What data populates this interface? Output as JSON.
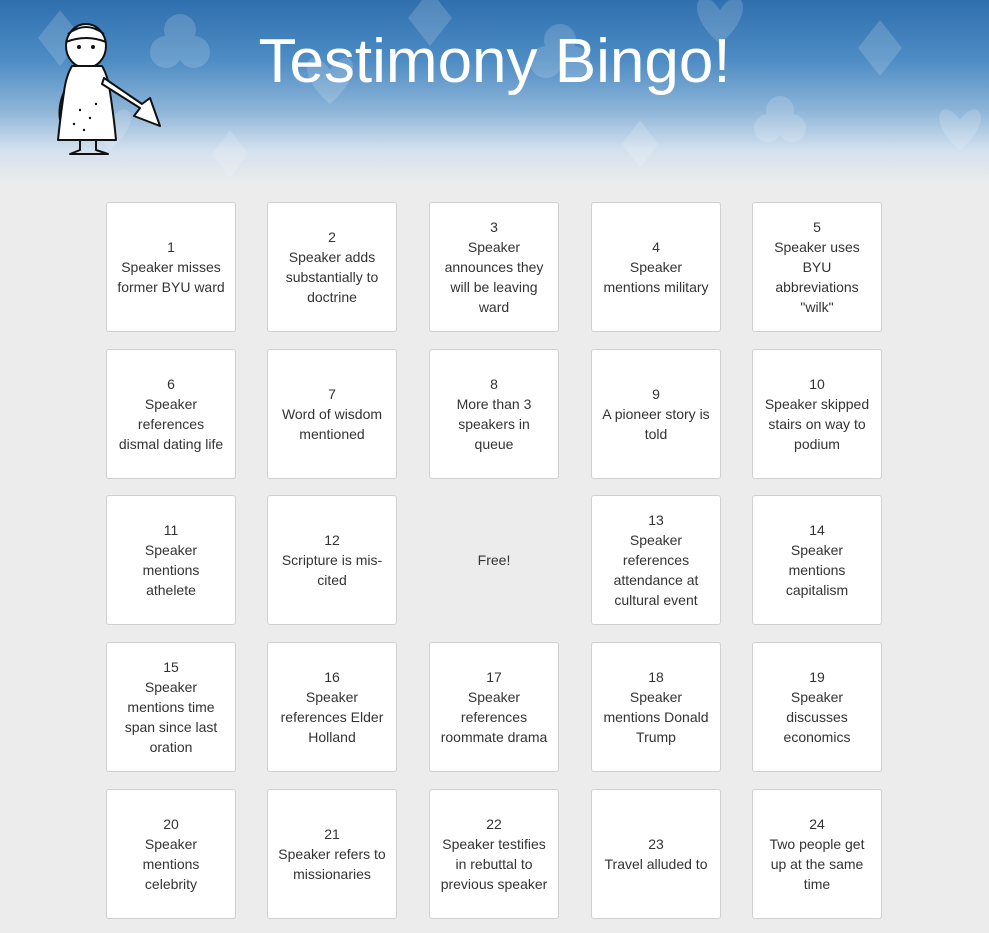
{
  "header": {
    "title": "Testimony Bingo!"
  },
  "mascot": {
    "icon": "pioneer-girl-trumpet-illustration"
  },
  "cards": [
    {
      "number": "1",
      "text": "Speaker misses former BYU ward"
    },
    {
      "number": "2",
      "text": "Speaker adds substantially to doctrine"
    },
    {
      "number": "3",
      "text": "Speaker announces they will be leaving ward"
    },
    {
      "number": "4",
      "text": "Speaker mentions military"
    },
    {
      "number": "5",
      "text": "Speaker uses BYU abbreviations \"wilk\""
    },
    {
      "number": "6",
      "text": "Speaker references dismal dating life"
    },
    {
      "number": "7",
      "text": "Word of wisdom mentioned"
    },
    {
      "number": "8",
      "text": "More than 3 speakers in queue"
    },
    {
      "number": "9",
      "text": "A pioneer story is told"
    },
    {
      "number": "10",
      "text": "Speaker skipped stairs on way to podium"
    },
    {
      "number": "11",
      "text": "Speaker mentions athelete"
    },
    {
      "number": "12",
      "text": "Scripture is mis-cited"
    },
    {
      "number": "",
      "text": "Free!",
      "free": true
    },
    {
      "number": "13",
      "text": "Speaker references attendance at cultural event"
    },
    {
      "number": "14",
      "text": "Speaker mentions capitalism"
    },
    {
      "number": "15",
      "text": "Speaker mentions time span since last oration"
    },
    {
      "number": "16",
      "text": "Speaker references Elder Holland"
    },
    {
      "number": "17",
      "text": "Speaker references roommate drama"
    },
    {
      "number": "18",
      "text": "Speaker mentions Donald Trump"
    },
    {
      "number": "19",
      "text": "Speaker discusses economics"
    },
    {
      "number": "20",
      "text": "Speaker mentions celebrity"
    },
    {
      "number": "21",
      "text": "Speaker refers to missionaries"
    },
    {
      "number": "22",
      "text": "Speaker testifies in rebuttal to previous speaker"
    },
    {
      "number": "23",
      "text": "Travel alluded to"
    },
    {
      "number": "24",
      "text": "Two people get up at the same time"
    }
  ]
}
